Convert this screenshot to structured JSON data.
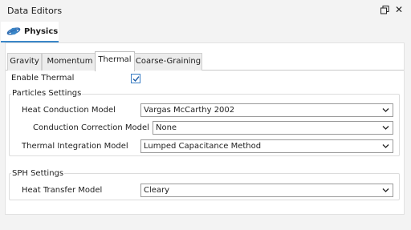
{
  "window": {
    "title": "Data Editors",
    "restore_icon": "restore-window-icon",
    "close_glyph": "✕"
  },
  "physics_tab": {
    "label": "Physics",
    "icon": "planet-icon"
  },
  "tabs": [
    {
      "label": "Gravity",
      "active": false
    },
    {
      "label": "Momentum",
      "active": false
    },
    {
      "label": "Thermal",
      "active": true
    },
    {
      "label": "Coarse-Graining",
      "active": false
    }
  ],
  "enable_thermal": {
    "label": "Enable Thermal",
    "checked": true
  },
  "particles": {
    "title": "Particles Settings",
    "heat_conduction": {
      "label": "Heat Conduction Model",
      "value": "Vargas McCarthy 2002"
    },
    "conduction_correction": {
      "label": "Conduction Correction Model",
      "value": "None"
    },
    "thermal_integration": {
      "label": "Thermal Integration Model",
      "value": "Lumped Capacitance Method"
    }
  },
  "sph": {
    "title": "SPH Settings",
    "heat_transfer": {
      "label": "Heat Transfer Model",
      "value": "Cleary"
    }
  },
  "colors": {
    "accent": "#3a86c8",
    "checkbox_border": "#3a7ec5"
  }
}
